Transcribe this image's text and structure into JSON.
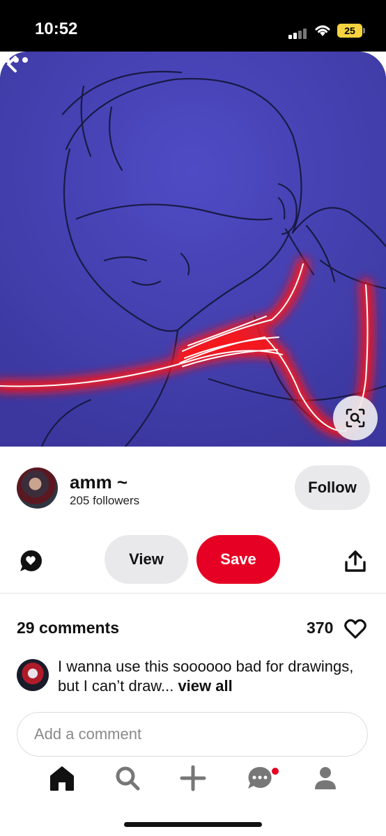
{
  "status_bar": {
    "time": "10:52",
    "battery": "25"
  },
  "pin": {
    "image_alt": "sketch of figure with glowing red string around neck"
  },
  "creator": {
    "name": "amm ~",
    "followers": "205 followers",
    "follow_label": "Follow"
  },
  "actions": {
    "view_label": "View",
    "save_label": "Save"
  },
  "engagement": {
    "comments_count": "29 comments",
    "likes": "370"
  },
  "top_comment": {
    "text": "I wanna use this soooooo bad for drawings, but I can’t draw... ",
    "view_all": "view all"
  },
  "comment_input": {
    "placeholder": "Add a comment"
  },
  "tabbar": {
    "tabs": [
      "home-tab",
      "search-tab",
      "create-tab",
      "messages-tab",
      "profile-tab"
    ]
  },
  "colors": {
    "brand_red": "#e60023",
    "pin_background": "#4a46b8",
    "glow_red": "#ff1a1a"
  }
}
